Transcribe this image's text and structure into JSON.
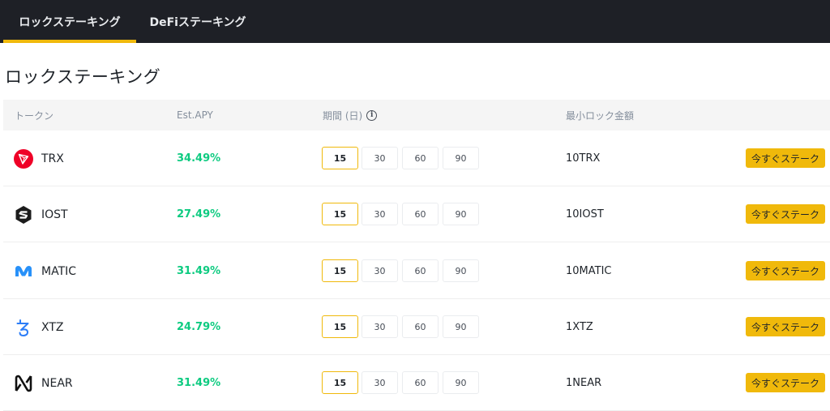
{
  "tabs": [
    {
      "label": "ロックステーキング",
      "active": true
    },
    {
      "label": "DeFiステーキング",
      "active": false
    }
  ],
  "page_title": "ロックステーキング",
  "columns": {
    "token": "トークン",
    "apy": "Est.APY",
    "duration": "期間 (日)",
    "min_lock": "最小ロック金額"
  },
  "durations": [
    "15",
    "30",
    "60",
    "90"
  ],
  "selected_duration": "15",
  "stake_label": "今すぐステーク",
  "colors": {
    "accent": "#f0b90b",
    "apy_green": "#0ecb81",
    "nav_bg": "#1e2026"
  },
  "rows": [
    {
      "token": "TRX",
      "icon": "trx-icon",
      "apy": "34.49%",
      "min_lock": "10TRX"
    },
    {
      "token": "IOST",
      "icon": "iost-icon",
      "apy": "27.49%",
      "min_lock": "10IOST"
    },
    {
      "token": "MATIC",
      "icon": "matic-icon",
      "apy": "31.49%",
      "min_lock": "10MATIC"
    },
    {
      "token": "XTZ",
      "icon": "xtz-icon",
      "apy": "24.79%",
      "min_lock": "1XTZ"
    },
    {
      "token": "NEAR",
      "icon": "near-icon",
      "apy": "31.49%",
      "min_lock": "1NEAR"
    }
  ]
}
